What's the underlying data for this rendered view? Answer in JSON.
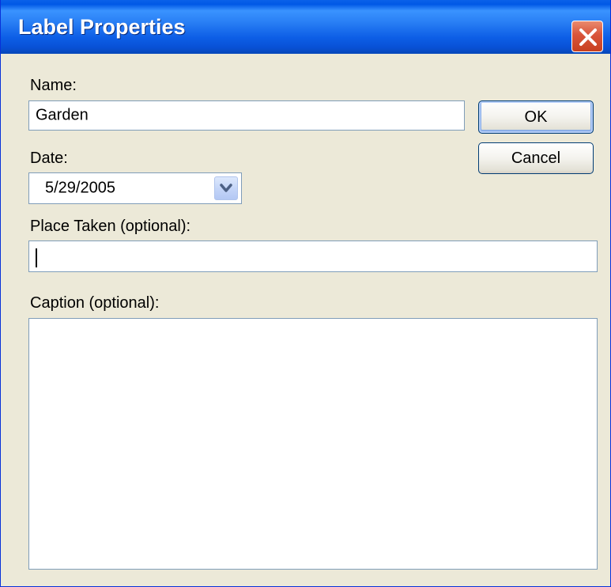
{
  "window": {
    "title": "Label Properties"
  },
  "form": {
    "name_label": "Name:",
    "name_value": "Garden",
    "date_label": "Date:",
    "date_value": "5/29/2005",
    "place_label": "Place Taken (optional):",
    "place_value": "",
    "caption_label": "Caption (optional):",
    "caption_value": ""
  },
  "buttons": {
    "ok_label": "OK",
    "cancel_label": "Cancel"
  },
  "icons": {
    "close": "close-icon",
    "dropdown": "chevron-down-icon"
  },
  "colors": {
    "titlebar": "#0a5ee8",
    "dialog_background": "#ece9d8",
    "input_border": "#7f9db9",
    "close_button": "#d9543a"
  }
}
